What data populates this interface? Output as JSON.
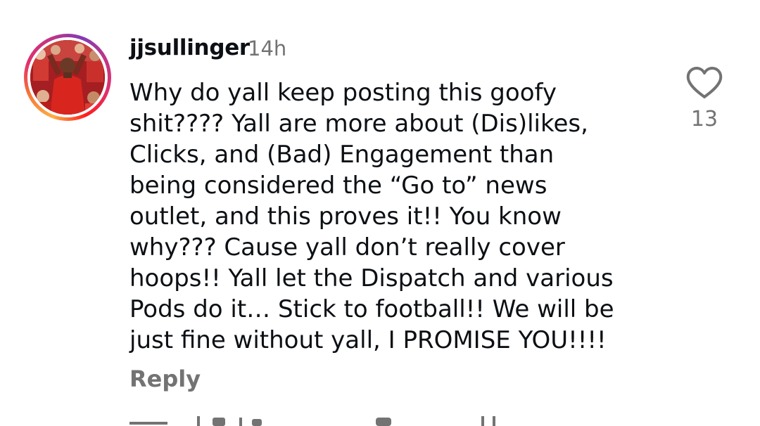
{
  "comment": {
    "username": "jjsullinger",
    "timestamp": "14h",
    "text_lines": [
      "Why do yall keep posting this goofy",
      "shit???? Yall are more about (Dis)likes,",
      "Clicks, and (Bad) Engagement than",
      "being considered the “Go to” news",
      "outlet, and this proves it!! You know",
      "why??? Cause yall don’t really cover",
      "hoops!! Yall let the Dispatch and various",
      "Pods do it… Stick to football!! We will be",
      "just fine without yall, I PROMISE YOU!!!!"
    ],
    "reply_label": "Reply",
    "like_count": "13",
    "like_icon": "heart-outline-icon",
    "avatar": "profile-photo",
    "story_ring_colors": [
      "#fcaf45",
      "#f77737",
      "#e1306c",
      "#c13584",
      "#833ab4"
    ]
  },
  "colors": {
    "primary_text": "#0c1014",
    "secondary_text": "#737373",
    "background": "#ffffff"
  }
}
